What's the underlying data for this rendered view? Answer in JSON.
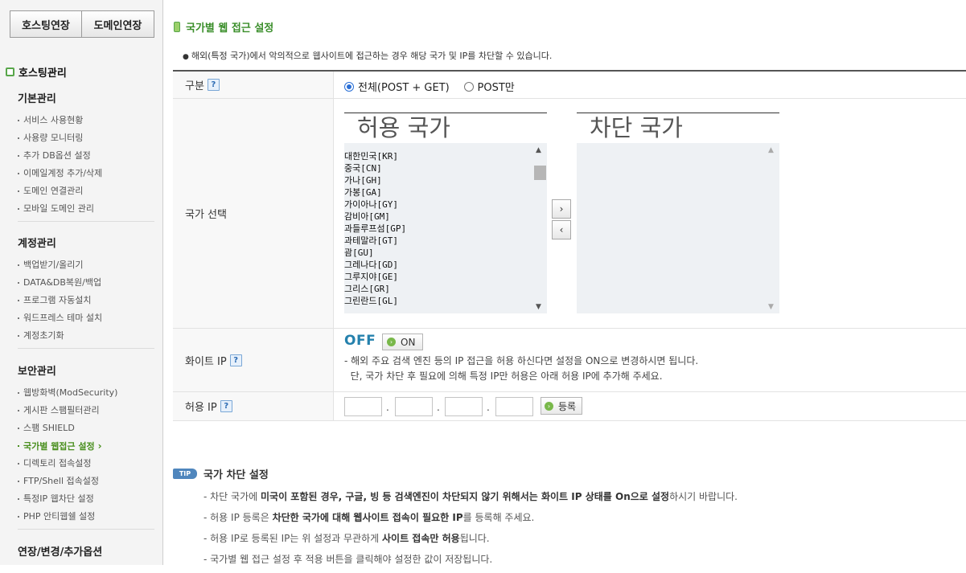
{
  "tabs": {
    "hosting": "호스팅연장",
    "domain": "도메인연장"
  },
  "sidebar": {
    "heading": "호스팅관리",
    "sections": [
      {
        "title": "기본관리",
        "items": [
          "서비스 사용현황",
          "사용량 모니터링",
          "추가 DB옵션 설정",
          "이메일계정 추가/삭제",
          "도메인 연결관리",
          "모바일 도메인 관리"
        ]
      },
      {
        "title": "계정관리",
        "items": [
          "백업받기/올리기",
          "DATA&DB복원/백업",
          "프로그램 자동설치",
          "워드프레스 테마 설치",
          "계정초기화"
        ]
      },
      {
        "title": "보안관리",
        "items": [
          "웹방화벽(ModSecurity)",
          "게시판 스팸필터관리",
          "스팸 SHIELD",
          "국가별 웹접근 설정",
          "디렉토리 접속설정",
          "FTP/Shell 접속설정",
          "특정IP 웹차단 설정",
          "PHP 안티웹쉘 설정"
        ]
      },
      {
        "title": "연장/변경/추가옵션",
        "items": []
      }
    ],
    "active_item": "국가별 웹접근 설정"
  },
  "main": {
    "title": "국가별 웹 접근 설정",
    "notice": "해외(특정 국가)에서 악의적으로 웹사이트에 접근하는 경우 해당 국가 및 IP를 차단할 수 있습니다.",
    "rows": {
      "type_label": "구분",
      "country_label": "국가 선택",
      "white_ip_label": "화이트 IP",
      "allow_ip_label": "허용 IP"
    },
    "type_options": {
      "all": "전체(POST + GET)",
      "post": "POST만",
      "selected": "all"
    },
    "allowed_box": {
      "title": "허용 국가",
      "entries": [
        "대한민국[KR]",
        "중국[CN]",
        "가나[GH]",
        "가봉[GA]",
        "가이아나[GY]",
        "감비아[GM]",
        "과들루프섬[GP]",
        "과테말라[GT]",
        "괌[GU]",
        "그레나다[GD]",
        "그루지야[GE]",
        "그리스[GR]",
        "그린란드[GL]"
      ]
    },
    "blocked_box": {
      "title": "차단 국가",
      "entries": []
    },
    "move_right": "›",
    "move_left": "‹",
    "white_ip": {
      "off_label": "OFF",
      "on_button": "ON",
      "desc_line1": "- 해외 주요 검색 엔진 등의 IP 접근을 허용 하신다면 설정을 ON으로 변경하시면 됩니다.",
      "desc_line2": "  단, 국가 차단 후 필요에 의해 특정 IP만 허용은 아래 허용 IP에 추가해 주세요."
    },
    "ip_separator": ".",
    "register_button": "등록",
    "help_glyph": "?"
  },
  "tip": {
    "badge": "TIP",
    "title": "국가 차단 설정",
    "lines": [
      {
        "a": "- 차단 국가에 ",
        "b": "미국이 포함된 경우, 구글, 빙 등 검색엔진이 차단되지 않기 위해서는 화이트 IP 상태를 On으로 설정",
        "c": "하시기 바랍니다."
      },
      {
        "a": "- 허용 IP 등록은 ",
        "b": "차단한 국가에 대해 웹사이트 접속이 필요한 IP",
        "c": "를 등록해 주세요."
      },
      {
        "a": "- 허용 IP로 등록된 IP는 위 설정과 무관하게 ",
        "b": "사이트 접속만 허용",
        "c": "됩니다."
      },
      {
        "a": "- 국가별 웹 접근 설정 후 적용 버튼을 클릭해야 설정한 값이 저장됩니다.",
        "b": "",
        "c": ""
      }
    ]
  }
}
